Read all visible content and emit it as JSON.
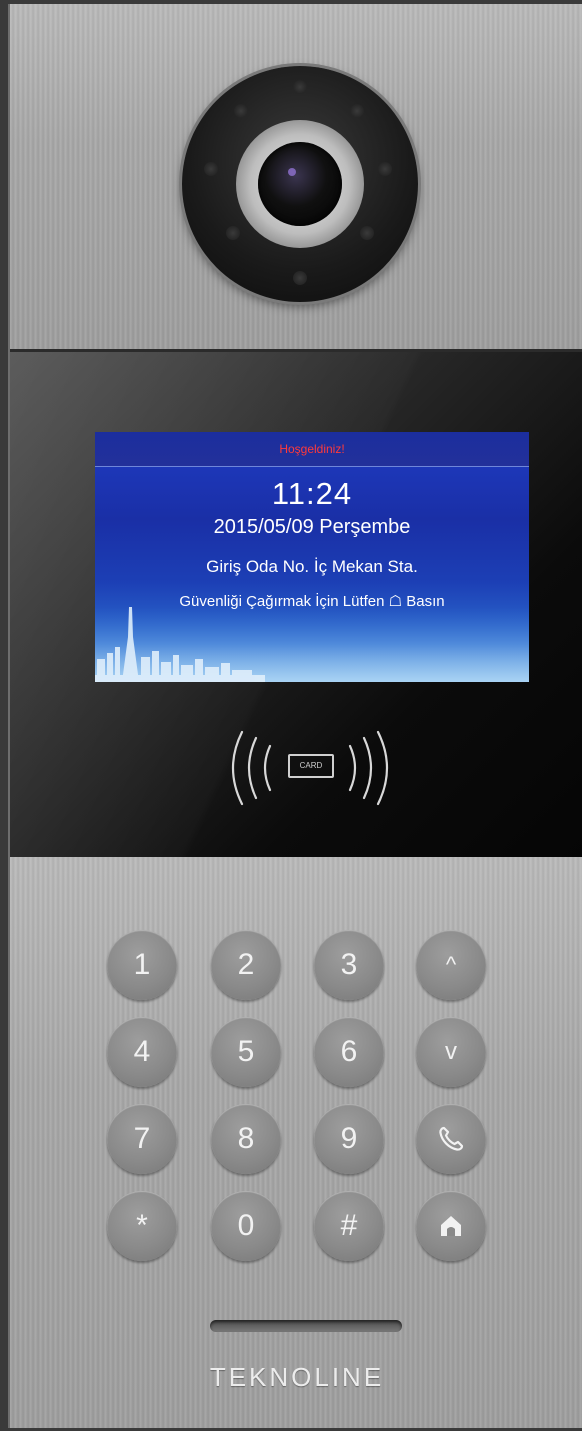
{
  "screen": {
    "welcome": "Hoşgeldiniz!",
    "time": "11:24",
    "date": "2015/05/09 Perşembe",
    "line1": "Giriş Oda No. İç Mekan Sta.",
    "line2": "Güvenliği Çağırmak İçin Lütfen ☖ Basın"
  },
  "card_reader": {
    "label": "CARD"
  },
  "keypad": {
    "keys": [
      "1",
      "2",
      "3",
      "^",
      "4",
      "5",
      "6",
      "v",
      "7",
      "8",
      "9",
      "call-icon",
      "*",
      "0",
      "#",
      "home-icon"
    ]
  },
  "brand": "TEKNOLINE",
  "colors": {
    "welcome_text": "#ff3a3a",
    "screen_bg": "#1f3cc4",
    "key_bg": "#8a8a8a"
  }
}
